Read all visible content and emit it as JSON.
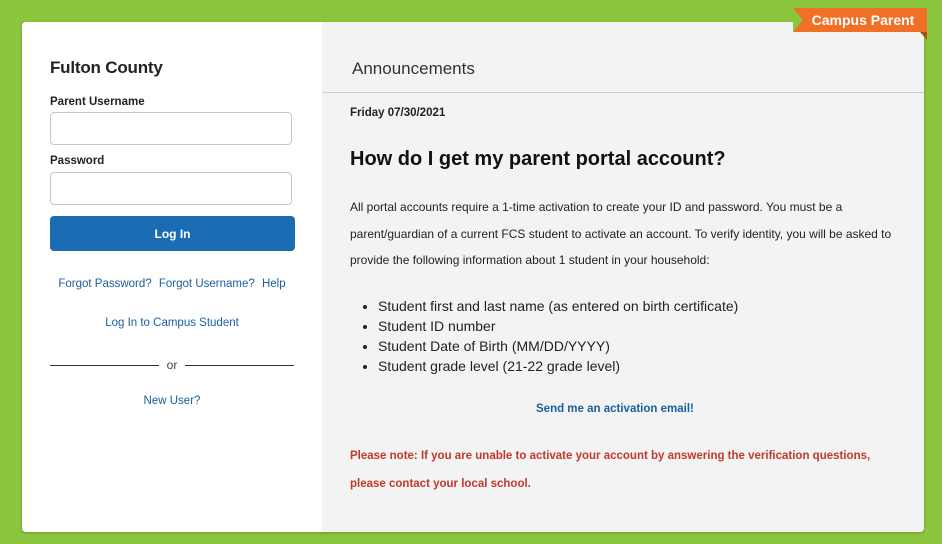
{
  "login": {
    "district": "Fulton County",
    "username_label": "Parent Username",
    "username_value": "",
    "password_label": "Password",
    "password_value": "",
    "login_button": "Log In",
    "forgot_password": "Forgot Password?",
    "forgot_username": "Forgot Username?",
    "help": "Help",
    "campus_student": "Log In to Campus Student",
    "or": "or",
    "new_user": "New User?"
  },
  "announcements": {
    "title": "Announcements",
    "date": "Friday 07/30/2021",
    "heading": "How do I get my parent portal account?",
    "body": "All portal accounts require a 1-time activation to create your ID and password.  You must be a parent/guardian of a current FCS student to activate an account. To verify identity, you will be asked to provide the following information about 1 student in your household:",
    "items": [
      "Student first and last name (as entered on birth certificate)",
      "Student ID number",
      "Student Date of Birth (MM/DD/YYYY)",
      "Student grade level (21-22 grade level)"
    ],
    "activation_link": "Send me an activation email!",
    "note": "Please note:  If you are unable to activate your account by answering the verification questions, please contact your local school."
  },
  "ribbon": {
    "label": "Campus Parent"
  },
  "colors": {
    "background": "#8cc63f",
    "primary_button": "#1a6db3",
    "link": "#1a5fa0",
    "ribbon": "#f07028",
    "note": "#c0392b"
  }
}
